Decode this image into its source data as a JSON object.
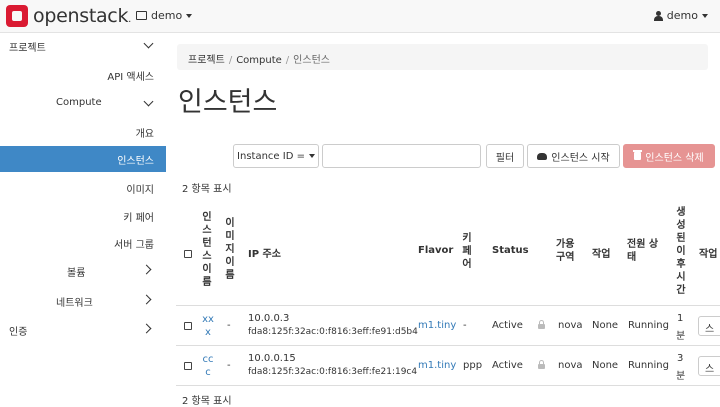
{
  "topbar": {
    "logo_text": "openstack",
    "logo_dot": ".",
    "project": "demo",
    "user": "demo"
  },
  "sidebar": {
    "project": "프로젝트",
    "api_access": "API 액세스",
    "compute": "Compute",
    "overview": "개요",
    "instances": "인스턴스",
    "images": "이미지",
    "key_pairs": "키 페어",
    "server_groups": "서버 그룹",
    "volumes": "볼륨",
    "network": "네트워크",
    "identity": "인증"
  },
  "breadcrumb": {
    "items": [
      "프로젝트",
      "Compute",
      "인스턴스"
    ],
    "sep": "/"
  },
  "page_title": "인스턴스",
  "toolbar": {
    "filter_select": "Instance ID =",
    "filter_button": "필터",
    "launch_button": "인스턴스 시작",
    "delete_button": "인스턴스 삭제"
  },
  "count_text": "2 항목 표시",
  "table": {
    "headers": {
      "name": "인스턴스이름",
      "image": "이미지이름",
      "ip": "IP 주소",
      "flavor": "Flavor",
      "key": "키페어",
      "status": "Status",
      "az": "가용\n구역",
      "task": "작업",
      "power": "전원 상\n태",
      "age": "생성된이후시간",
      "actions": "작업"
    },
    "rows": [
      {
        "name": "xxx",
        "image": "-",
        "ip1": "10.0.0.3",
        "ip2": "fda8:125f:32ac:0:f816:3eff:fe91:d5b4",
        "flavor": "m1.tiny",
        "key": "-",
        "status": "Active",
        "az": "nova",
        "task": "None",
        "power": "Running",
        "age1": "1",
        "age2": "분",
        "action": "스냅"
      },
      {
        "name": "ccc",
        "image": "-",
        "ip1": "10.0.0.15",
        "ip2": "fda8:125f:32ac:0:f816:3eff:fe21:19c4",
        "flavor": "m1.tiny",
        "key": "ppp",
        "status": "Active",
        "az": "nova",
        "task": "None",
        "power": "Running",
        "age1": "3",
        "age2": "분",
        "action": "스냅"
      }
    ]
  },
  "icons": {
    "logo": "openstack-logo-icon",
    "project": "project-icon",
    "user": "user-icon",
    "lock": "lock-icon",
    "cloud": "cloud-upload-icon",
    "trash": "trash-icon"
  },
  "colors": {
    "brand": "#da1a32",
    "active_nav": "#3f88c6",
    "danger": "#e69493",
    "link": "#337ab7"
  }
}
